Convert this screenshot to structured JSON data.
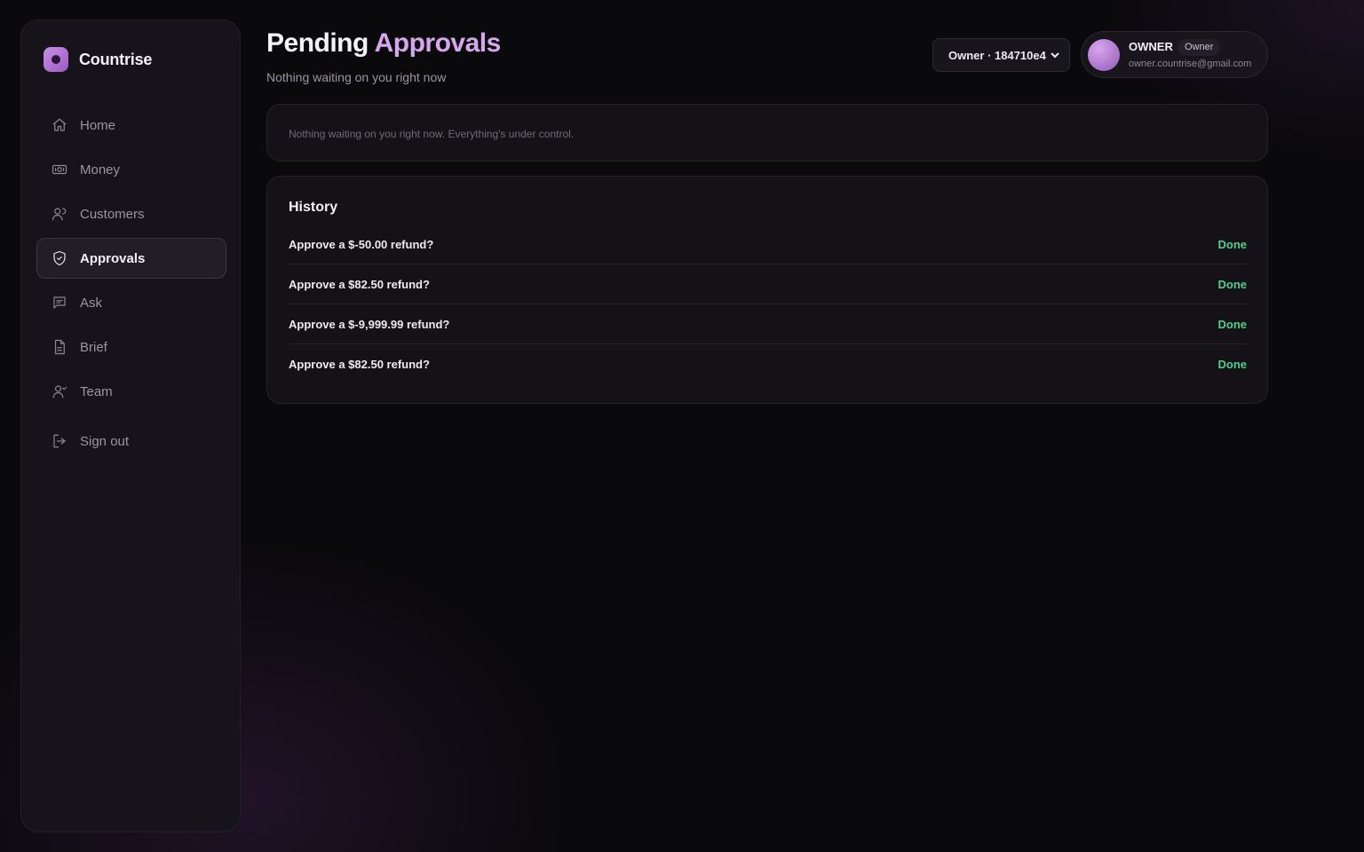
{
  "brand": {
    "name": "Countrise"
  },
  "sidebar": {
    "items": [
      {
        "label": "Home",
        "icon": "home-icon"
      },
      {
        "label": "Money",
        "icon": "money-icon"
      },
      {
        "label": "Customers",
        "icon": "customers-icon"
      },
      {
        "label": "Approvals",
        "icon": "shield-check-icon",
        "active": true
      },
      {
        "label": "Ask",
        "icon": "chat-icon"
      },
      {
        "label": "Brief",
        "icon": "document-icon"
      },
      {
        "label": "Team",
        "icon": "team-icon"
      }
    ],
    "signout_label": "Sign out"
  },
  "header": {
    "title_main": "Pending",
    "title_accent": "Approvals",
    "subtitle": "Nothing waiting on you right now"
  },
  "org_select": {
    "value": "Owner · 184710e4"
  },
  "user": {
    "name": "OWNER",
    "role": "Owner",
    "email": "owner.countrise@gmail.com"
  },
  "empty_state": {
    "text": "Nothing waiting on you right now. Everything's under control."
  },
  "history": {
    "title": "History",
    "rows": [
      {
        "question": "Approve a $-50.00 refund?",
        "status": "Done"
      },
      {
        "question": "Approve a $82.50 refund?",
        "status": "Done"
      },
      {
        "question": "Approve a $-9,999.99 refund?",
        "status": "Done"
      },
      {
        "question": "Approve a $82.50 refund?",
        "status": "Done"
      }
    ]
  },
  "colors": {
    "accent": "#d6a7ec",
    "success": "#53cf8d",
    "background": "#0a090c"
  }
}
